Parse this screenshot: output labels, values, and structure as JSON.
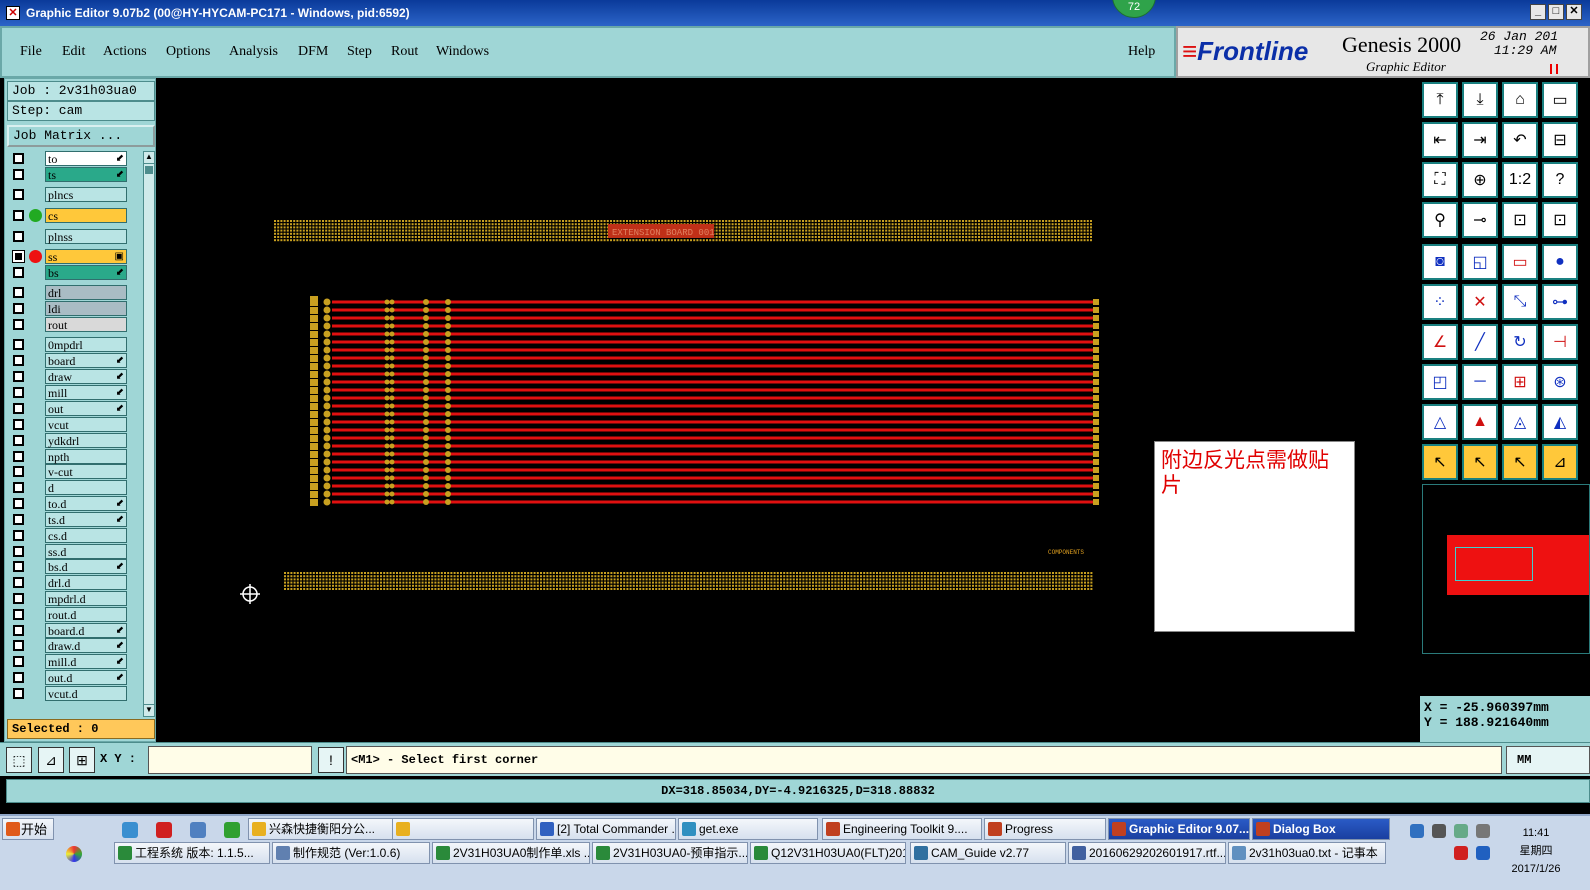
{
  "window": {
    "title": "Graphic Editor 9.07b2 (00@HY-HYCAM-PC171 - Windows, pid:6592)",
    "badge": "72"
  },
  "menu": {
    "items": [
      "File",
      "Edit",
      "Actions",
      "Options",
      "Analysis",
      "DFM",
      "Step",
      "Rout",
      "Windows"
    ],
    "help": "Help"
  },
  "logo": {
    "brand": "Frontline",
    "product": "Genesis 2000",
    "subtitle": "Graphic Editor",
    "date_line1": "26 Jan 201",
    "date_line2": "11:29 AM"
  },
  "job": {
    "job_label": "Job : 2v31h03ua0",
    "step_label": "Step: cam",
    "matrix_button": "Job Matrix ..."
  },
  "layers": [
    {
      "name": "to",
      "bg": "#ffffff",
      "arrow": "⬋"
    },
    {
      "name": "ts",
      "bg": "#2aa98a",
      "arrow": "⬋"
    },
    {
      "name": "plncs",
      "bg": "#b9e4e4",
      "arrow": ""
    },
    {
      "name": "cs",
      "bg": "#ffc83a",
      "arrow": "",
      "dot": "#22aa22"
    },
    {
      "name": "plnss",
      "bg": "#b9e4e4",
      "arrow": ""
    },
    {
      "name": "ss",
      "bg": "#ffc83a",
      "arrow": "▣",
      "dot": "#ee1111",
      "active": true
    },
    {
      "name": "bs",
      "bg": "#2aa98a",
      "arrow": "⬋"
    },
    {
      "name": "drl",
      "bg": "#a9bcc4",
      "arrow": ""
    },
    {
      "name": "ldi",
      "bg": "#a9bcc4",
      "arrow": ""
    },
    {
      "name": "rout",
      "bg": "#d9d9d9",
      "arrow": ""
    },
    {
      "name": "0mpdrl",
      "bg": "#b9e4e4",
      "arrow": ""
    },
    {
      "name": "board",
      "bg": "#b9e4e4",
      "arrow": "⬋"
    },
    {
      "name": "draw",
      "bg": "#b9e4e4",
      "arrow": "⬋"
    },
    {
      "name": "mill",
      "bg": "#b9e4e4",
      "arrow": "⬋"
    },
    {
      "name": "out",
      "bg": "#b9e4e4",
      "arrow": "⬋"
    },
    {
      "name": "vcut",
      "bg": "#b9e4e4",
      "arrow": ""
    },
    {
      "name": "ydkdrl",
      "bg": "#b9e4e4",
      "arrow": ""
    },
    {
      "name": "npth",
      "bg": "#b9e4e4",
      "arrow": ""
    },
    {
      "name": "v-cut",
      "bg": "#b9e4e4",
      "arrow": ""
    },
    {
      "name": "d",
      "bg": "#b9e4e4",
      "arrow": ""
    },
    {
      "name": "to.d",
      "bg": "#b9e4e4",
      "arrow": "⬋"
    },
    {
      "name": "ts.d",
      "bg": "#b9e4e4",
      "arrow": "⬋"
    },
    {
      "name": "cs.d",
      "bg": "#b9e4e4",
      "arrow": ""
    },
    {
      "name": "ss.d",
      "bg": "#b9e4e4",
      "arrow": ""
    },
    {
      "name": "bs.d",
      "bg": "#b9e4e4",
      "arrow": "⬋"
    },
    {
      "name": "drl.d",
      "bg": "#b9e4e4",
      "arrow": ""
    },
    {
      "name": "mpdrl.d",
      "bg": "#b9e4e4",
      "arrow": ""
    },
    {
      "name": "rout.d",
      "bg": "#b9e4e4",
      "arrow": ""
    },
    {
      "name": "board.d",
      "bg": "#b9e4e4",
      "arrow": "⬋"
    },
    {
      "name": "draw.d",
      "bg": "#b9e4e4",
      "arrow": "⬋"
    },
    {
      "name": "mill.d",
      "bg": "#b9e4e4",
      "arrow": "⬋"
    },
    {
      "name": "out.d",
      "bg": "#b9e4e4",
      "arrow": "⬋"
    },
    {
      "name": "vcut.d",
      "bg": "#b9e4e4",
      "arrow": ""
    }
  ],
  "selected": "Selected : 0",
  "canvas": {
    "note_text": "附边反光点需做贴片",
    "pcb_label_top": "EXTENSION BOARD 001",
    "pcb_label_mid": "COMPONENTS",
    "colors": {
      "trace": "#e01010",
      "pad": "#c8a020"
    }
  },
  "coords": {
    "x": "X = -25.960397mm",
    "y": "Y = 188.921640mm"
  },
  "cmd": {
    "xy_label": "X Y :",
    "xy_value": "",
    "prompt": "<M1> - Select first corner",
    "unit": "MM"
  },
  "status": "DX=318.85034,DY=-4.9216325,D=318.88832",
  "taskbar": {
    "start": "开始",
    "row1": [
      {
        "label": "兴森快捷衡阳分公...",
        "color": "#e8b020"
      },
      {
        "label": "",
        "color": "#e8b020"
      },
      {
        "label": "[2] Total Commander ...",
        "color": "#3060c0"
      },
      {
        "label": "get.exe",
        "color": "#3090c0"
      },
      {
        "label": "Engineering Toolkit 9....",
        "color": "#c04020"
      },
      {
        "label": "Progress",
        "color": "#c04020"
      },
      {
        "label": "Graphic Editor 9.07...",
        "color": "#c04020",
        "active": true
      },
      {
        "label": "Dialog Box",
        "color": "#c04020",
        "active": true
      }
    ],
    "row2": [
      {
        "label": "工程系统  版本: 1.1.5...",
        "color": "#2a8a3a"
      },
      {
        "label": "制作规范 (Ver:1.0.6)",
        "color": "#6080b0"
      },
      {
        "label": "2V31H03UA0制作单.xls ...",
        "color": "#2a8a3a"
      },
      {
        "label": "2V31H03UA0-预审指示...",
        "color": "#2a8a3a"
      },
      {
        "label": "Q12V31H03UA0(FLT)201...",
        "color": "#2a8a3a"
      },
      {
        "label": "CAM_Guide v2.77",
        "color": "#3070a0"
      },
      {
        "label": "20160629202601917.rtf...",
        "color": "#4060a0"
      },
      {
        "label": "2v31h03ua0.txt - 记事本",
        "color": "#6090c0"
      }
    ],
    "clock_time": "11:41",
    "clock_day": "星期四",
    "clock_date": "2017/1/26"
  }
}
